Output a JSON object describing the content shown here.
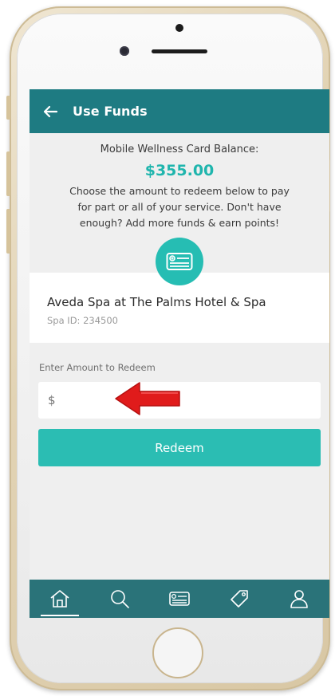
{
  "header": {
    "title": "Use Funds",
    "back_icon": "back-arrow-icon"
  },
  "balance": {
    "label": "Mobile Wellness Card Balance:",
    "value": "$355.00"
  },
  "instructions": "Choose the amount to redeem below to pay for part or all of your service. Don't have enough? Add more funds & earn points!",
  "spa": {
    "name": "Aveda Spa at The Palms Hotel & Spa",
    "id_text": "Spa ID: 234500"
  },
  "redeem_form": {
    "label": "Enter Amount to Redeem",
    "input_placeholder": "$",
    "button_label": "Redeem"
  },
  "bottom_nav": {
    "items": [
      {
        "name": "home",
        "icon": "home-icon",
        "active": true
      },
      {
        "name": "search",
        "icon": "search-icon",
        "active": false
      },
      {
        "name": "wallet",
        "icon": "card-icon",
        "active": false
      },
      {
        "name": "deals",
        "icon": "tag-icon",
        "active": false
      },
      {
        "name": "profile",
        "icon": "user-icon",
        "active": false
      }
    ]
  },
  "colors": {
    "header": "#1e7b82",
    "accent": "#2bbdb3",
    "nav": "#2a7379",
    "annotation_arrow": "#e01b1b"
  }
}
